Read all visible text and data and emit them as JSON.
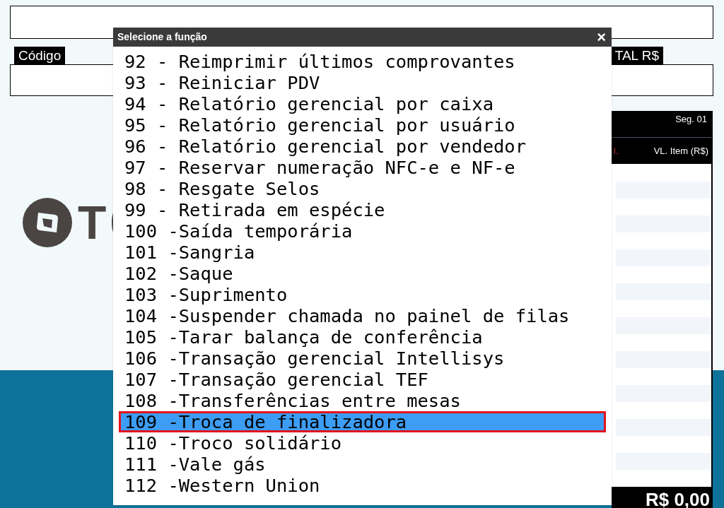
{
  "header": {
    "code_label": "Código",
    "total_label": "TAL R$"
  },
  "logo": {
    "text": "T"
  },
  "items_panel": {
    "segment": "Seg. 01",
    "column_1": "l.",
    "column_2": "VL. Item (R$)",
    "total": "R$ 0,00"
  },
  "dialog": {
    "title": "Selecione a função",
    "close": "×",
    "items": [
      {
        "label": "92 - Reimprimir últimos comprovantes",
        "selected": false
      },
      {
        "label": "93 - Reiniciar PDV",
        "selected": false
      },
      {
        "label": "94 - Relatório gerencial por caixa",
        "selected": false
      },
      {
        "label": "95 - Relatório gerencial por usuário",
        "selected": false
      },
      {
        "label": "96 - Relatório gerencial por vendedor",
        "selected": false
      },
      {
        "label": "97 - Reservar numeração NFC-e e NF-e",
        "selected": false
      },
      {
        "label": "98 - Resgate Selos",
        "selected": false
      },
      {
        "label": "99 - Retirada em espécie",
        "selected": false
      },
      {
        "label": "100 -Saída temporária",
        "selected": false
      },
      {
        "label": "101 -Sangria",
        "selected": false
      },
      {
        "label": "102 -Saque",
        "selected": false
      },
      {
        "label": "103 -Suprimento",
        "selected": false
      },
      {
        "label": "104 -Suspender chamada no painel de filas",
        "selected": false
      },
      {
        "label": "105 -Tarar balança de conferência",
        "selected": false
      },
      {
        "label": "106 -Transação gerencial Intellisys",
        "selected": false
      },
      {
        "label": "107 -Transação gerencial TEF",
        "selected": false
      },
      {
        "label": "108 -Transferências entre mesas",
        "selected": false
      },
      {
        "label": "109 -Troca de finalizadora",
        "selected": true
      },
      {
        "label": "110 -Troco solidário",
        "selected": false
      },
      {
        "label": "111 -Vale gás",
        "selected": false
      },
      {
        "label": "112 -Western Union",
        "selected": false
      }
    ]
  }
}
